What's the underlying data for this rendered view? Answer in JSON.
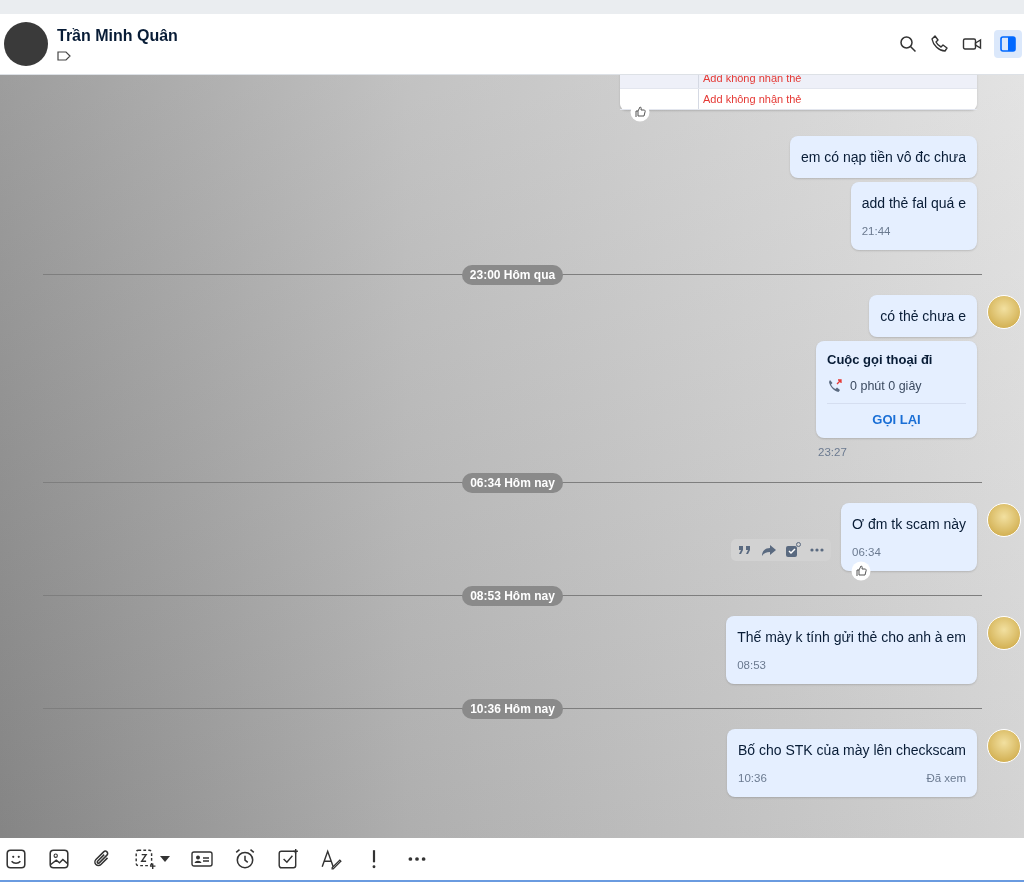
{
  "header": {
    "name": "Trần Minh Quân",
    "panel_toggle_on": true
  },
  "messages": [
    {
      "kind": "table",
      "rows": [
        "Add không nhận thẻ",
        "Add không nhận thẻ"
      ],
      "reaction": true
    },
    {
      "kind": "text",
      "text": "em có nạp tiền vô đc chưa"
    },
    {
      "kind": "text",
      "text": "add thẻ fal quá e",
      "time": "21:44"
    },
    {
      "kind": "divider",
      "label": "23:00 Hôm qua"
    },
    {
      "kind": "text",
      "text": "có thẻ chưa e",
      "avatar": true
    },
    {
      "kind": "call",
      "title": "Cuộc gọi thoại đi",
      "duration": "0 phút 0 giây",
      "action": "GỌI LẠI",
      "time": "23:27"
    },
    {
      "kind": "divider",
      "label": "06:34 Hôm nay"
    },
    {
      "kind": "text",
      "text": "Ơ đm tk scam này",
      "time": "06:34",
      "avatar": true,
      "reaction": true,
      "actions": true
    },
    {
      "kind": "divider",
      "label": "08:53 Hôm nay"
    },
    {
      "kind": "text",
      "text": "Thế mày k tính gửi thẻ cho anh à em",
      "time": "08:53",
      "avatar": true
    },
    {
      "kind": "divider",
      "label": "10:36 Hôm nay"
    },
    {
      "kind": "text",
      "text": "Bố cho STK của mày lên checkscam",
      "time": "10:36",
      "seen": "Đã xem",
      "avatar": true
    }
  ]
}
